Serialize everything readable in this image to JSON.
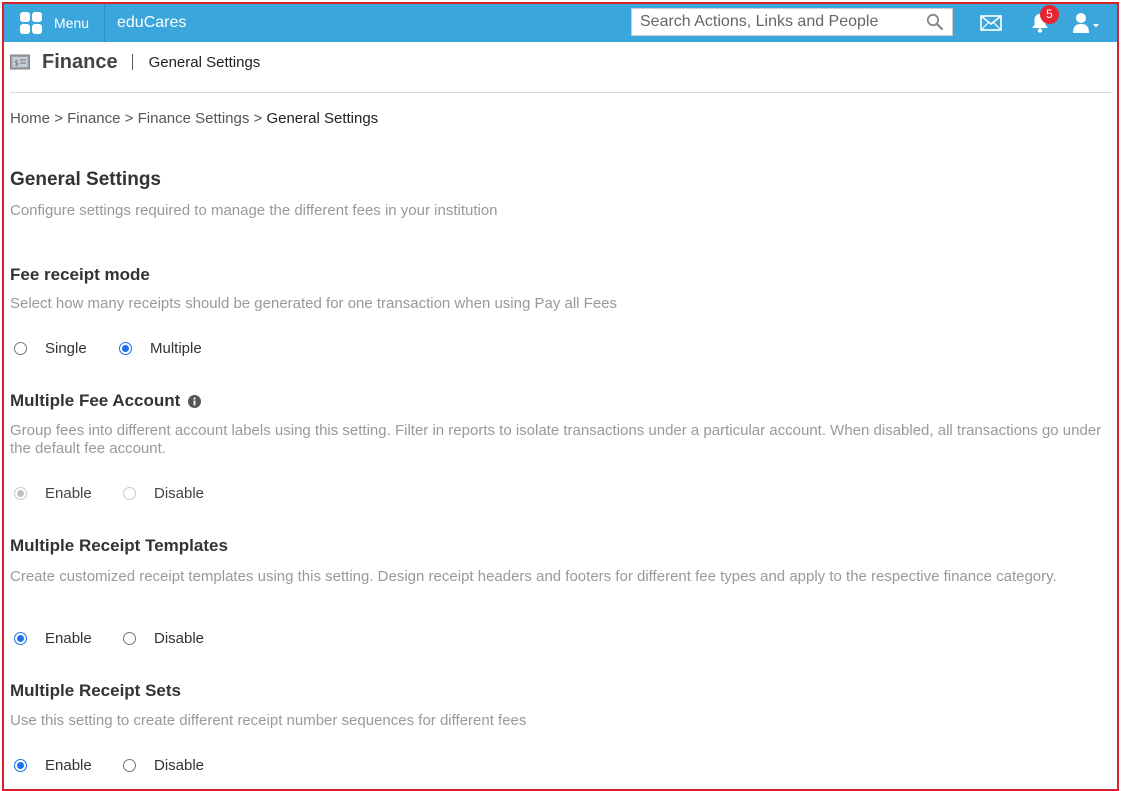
{
  "topbar": {
    "menu_label": "Menu",
    "brand": "eduCares",
    "search_placeholder": "Search Actions, Links and People",
    "notification_count": "5",
    "accent_color": "#3aa6dc"
  },
  "header": {
    "title": "Finance",
    "subtitle": "General Settings"
  },
  "breadcrumb": {
    "items": [
      "Home",
      "Finance",
      "Finance Settings"
    ],
    "separator": ">",
    "current": "General Settings"
  },
  "main": {
    "title": "General Settings",
    "description": "Configure settings required to manage the different fees in your institution",
    "sections": [
      {
        "title": "Fee receipt mode",
        "description": "Select how many receipts should be generated for one transaction when using Pay all Fees",
        "options": [
          "Single",
          "Multiple"
        ],
        "selected": "Multiple"
      },
      {
        "title": "Multiple Fee Account",
        "description": "Group fees into different account labels using this setting. Filter in reports to isolate transactions under a particular account. When disabled, all transactions go under the default fee account.",
        "options": [
          "Enable",
          "Disable"
        ],
        "selected": "Enable",
        "disabled": true
      },
      {
        "title": "Multiple Receipt Templates",
        "description": "Create customized receipt templates using this setting. Design receipt headers and footers for different fee types and apply to the respective finance category.",
        "options": [
          "Enable",
          "Disable"
        ],
        "selected": "Enable"
      },
      {
        "title": "Multiple Receipt Sets",
        "description": "Use this setting to create different receipt number sequences for different fees",
        "options": [
          "Enable",
          "Disable"
        ],
        "selected": "Enable"
      }
    ]
  },
  "icons": {
    "menu": "grid-icon",
    "search": "search-icon",
    "mail": "mail-icon",
    "notifications": "bell-icon",
    "user": "user-icon",
    "finance": "money-icon",
    "info": "info-icon"
  }
}
